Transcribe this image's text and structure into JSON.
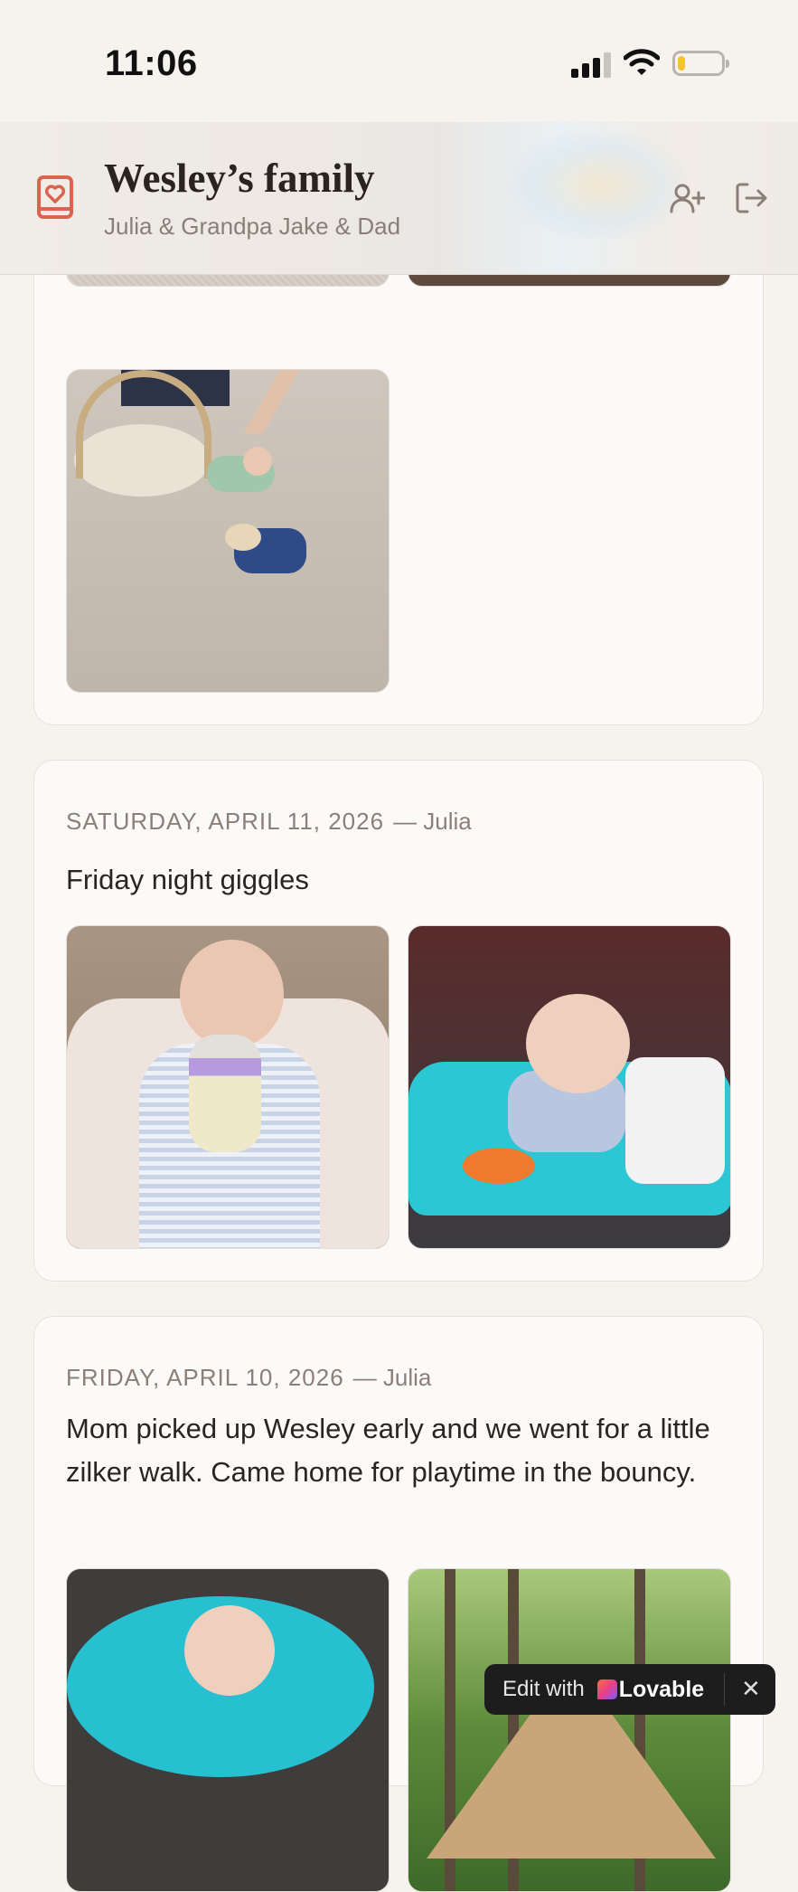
{
  "status_bar": {
    "time": "11:06",
    "icons": [
      "cellular-signal-icon",
      "wifi-icon",
      "battery-icon"
    ],
    "battery_level": 0.15
  },
  "header": {
    "title": "Wesley’s family",
    "subtitle": "Julia & Grandpa Jake & Dad",
    "logo_icon": "photo-album-heart-icon",
    "actions": [
      "add-member-icon",
      "sign-out-icon"
    ]
  },
  "feed": [
    {
      "photos": [
        "carpet photo",
        "bouncer photo",
        "playmat photo"
      ]
    },
    {
      "date": "SATURDAY, APRIL 11, 2026",
      "author": "— Julia",
      "caption": "Friday night giggles"
    },
    {
      "date": "FRIDAY, APRIL 10, 2026",
      "author": "— Julia",
      "caption": "Mom picked up Wesley early and we went for a little zilker walk. Came home for playtime in the bouncy."
    }
  ],
  "badge": {
    "edit_label": "Edit with",
    "brand": "Lovable",
    "close_glyph": "✕"
  },
  "colors": {
    "accent": "#d9654f",
    "background": "#f6f3ef",
    "card": "#fbfaf8",
    "muted_text": "#8b7f78"
  }
}
